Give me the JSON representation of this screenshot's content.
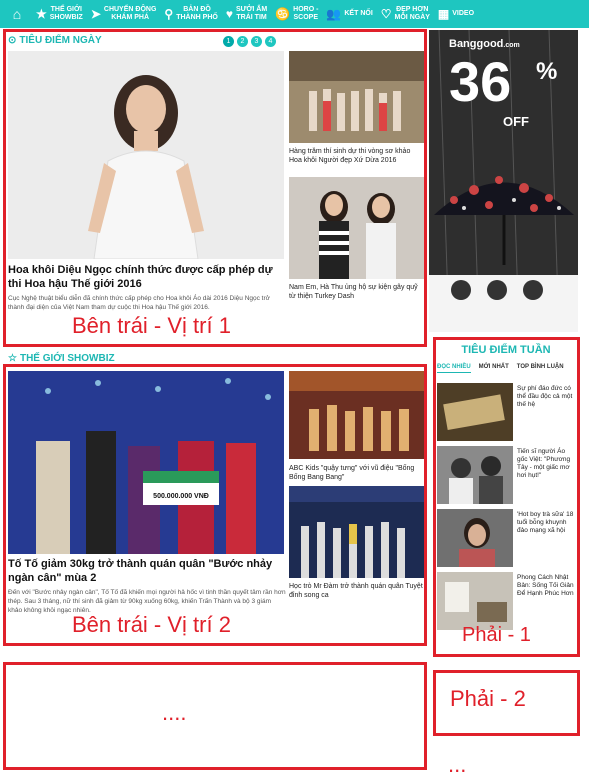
{
  "nav": {
    "home_icon": "home-icon",
    "items": [
      {
        "icon": "star-icon",
        "line1": "THẾ GIỚI",
        "line2": "SHOWBIZ"
      },
      {
        "icon": "plane-icon",
        "line1": "CHUYẾN ĐỘNG",
        "line2": "KHÁM PHÁ"
      },
      {
        "icon": "pin-icon",
        "line1": "BẢN ĐỒ",
        "line2": "THÀNH PHỐ"
      },
      {
        "icon": "heart-hands-icon",
        "line1": "SƯỞI ẤM",
        "line2": "TRÁI TIM"
      },
      {
        "icon": "horoscope-icon",
        "line1": "HORO -",
        "line2": "SCOPE"
      },
      {
        "icon": "people-icon",
        "line1": "KẾT NỐI",
        "line2": ""
      },
      {
        "icon": "lips-icon",
        "line1": "ĐẸP HƠN",
        "line2": "MỖI NGÀY"
      },
      {
        "icon": "video-icon",
        "line1": "VIDEO",
        "line2": ""
      }
    ]
  },
  "section1": {
    "title": "TIÊU ĐIỂM NGÀY",
    "pages": [
      "1",
      "2",
      "3",
      "4"
    ],
    "main_title": "Hoa khôi Diệu Ngọc chính thức được cấp phép dự thi Hoa hậu Thế giới 2016",
    "main_desc": "Cục Nghệ thuật biểu diễn đã chính thức cấp phép cho Hoa khôi Áo dài 2016 Diệu Ngọc trở thành đại diện của Việt Nam tham dự cuộc thi Hoa hậu Thế giới 2016.",
    "side1": "Hàng trăm thí sinh dự thi vòng sơ khảo Hoa khôi Người đẹp Xứ Dừa 2016",
    "side2": "Nam Em, Hà Thu ủng hộ sự kiện gây quỹ từ thiện Turkey Dash",
    "overlay": "Bên trái - Vị trí 1"
  },
  "section2": {
    "title": "THẾ GIỚI SHOWBIZ",
    "main_title": "Tố Tố giảm 30kg trở thành quán quân \"Bước nhảy ngàn cân\" mùa 2",
    "main_desc": "Đến với \"Bước nhảy ngàn cân\", Tố Tố đã khiến mọi người hả hốc vì tinh thần quyết tâm rần hơn thép. Sau 3 tháng, nữ thí sinh đã giảm từ 90kg xuống 60kg, khiến Trấn Thành và bộ 3 giám khảo không khỏi ngạc nhiên.",
    "prize": "500.000.000 VNĐ",
    "side1": "ABC Kids \"quậy tưng\" với vũ điệu \"Bống Bống Bang Bang\"",
    "side2": "Học trò Mr Đàm trở thành quán quân Tuyệt đỉnh song ca",
    "overlay": "Bên trái - Vị trí 2"
  },
  "ad": {
    "brand": "Banggood",
    "brand_sub": ".com",
    "big": "36",
    "pct": "%",
    "off": "OFF"
  },
  "right_box": {
    "title": "TIÊU ĐIỂM TUẦN",
    "tabs": [
      "ĐỌC NHIỀU",
      "MỚI NHẤT",
      "TOP BÌNH LUẬN"
    ],
    "items": [
      "Sự phí đáo đức có thể đầu độc cả một thế hệ",
      "Tiến sĩ người Áo gốc Việt: \"Phương Tây - một giấc mơ hơi hụt!\"",
      "'Hot boy trà sữa' 18 tuổi bỗng khuynh đảo mạng xã hội",
      "Phong Cách Nhật Bản: Sống Tối Giản Để Hạnh Phúc Hơn"
    ],
    "overlay": "Phải - 1"
  },
  "placeholders": {
    "left3": "....",
    "right2": "Phải - 2",
    "right3": "..."
  },
  "colors": {
    "teal": "#1ec6c0",
    "red": "#e0202a"
  }
}
